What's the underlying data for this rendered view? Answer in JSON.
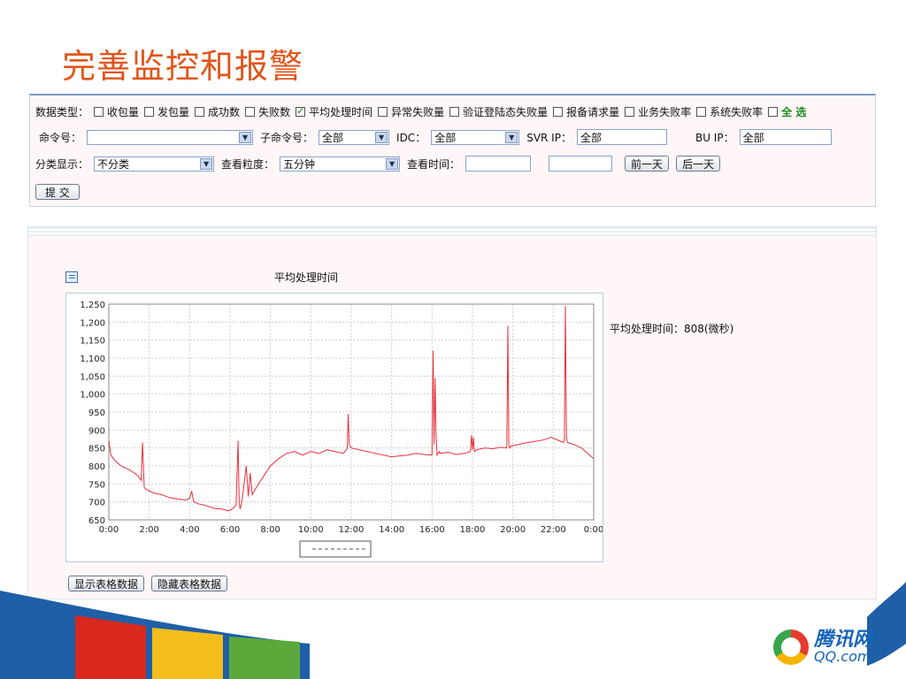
{
  "slide": {
    "title": "完善监控和报警"
  },
  "filters": {
    "data_type_label": "数据类型：",
    "checkboxes": [
      {
        "label": "收包量",
        "checked": false
      },
      {
        "label": "发包量",
        "checked": false
      },
      {
        "label": "成功数",
        "checked": false
      },
      {
        "label": "失败数",
        "checked": false
      },
      {
        "label": "平均处理时间",
        "checked": true
      },
      {
        "label": "异常失败量",
        "checked": false
      },
      {
        "label": "验证登陆态失败量",
        "checked": false
      },
      {
        "label": "报备请求量",
        "checked": false
      },
      {
        "label": "业务失败率",
        "checked": false
      },
      {
        "label": "系统失败率",
        "checked": false
      }
    ],
    "select_all": "全 选",
    "command_label": "命令号：",
    "command_value": "",
    "subcommand_label": "子命令号：",
    "subcommand_value": "全部",
    "idc_label": "IDC：",
    "idc_value": "全部",
    "svr_ip_label": "SVR IP：",
    "svr_ip_value": "全部",
    "bu_ip_label": "BU IP：",
    "bu_ip_value": "全部",
    "category_label": "分类显示：",
    "category_value": "不分类",
    "granularity_label": "查看粒度：",
    "granularity_value": "五分钟",
    "view_time_label": "查看时间：",
    "view_time_value": "",
    "view_time_value2": "",
    "prev_day": "前一天",
    "next_day": "后一天",
    "submit": "提 交"
  },
  "chart_section": {
    "heading": "平均处理时间",
    "side_stat": "平均处理时间：808(微秒)",
    "show_table": "显示表格数据",
    "hide_table": "隐藏表格数据"
  },
  "colors": {
    "line": "#e8303a",
    "title": "#e0561c",
    "accent": "#1a8a1a"
  },
  "chart_data": {
    "type": "line",
    "title": "",
    "xlabel": "",
    "ylabel": "",
    "ylim": [
      650,
      1250
    ],
    "xlim": [
      0,
      24
    ],
    "yticks": [
      "650",
      "700",
      "750",
      "800",
      "850",
      "900",
      "950",
      "1,000",
      "1,050",
      "1,100",
      "1,150",
      "1,200",
      "1,250"
    ],
    "xticks": [
      "0:00",
      "2:00",
      "4:00",
      "6:00",
      "8:00",
      "10:00",
      "12:00",
      "14:00",
      "16:00",
      "18:00",
      "20:00",
      "22:00",
      "0:00"
    ],
    "grid": true,
    "series": [
      {
        "x": [
          0.0,
          0.1,
          0.3,
          0.6,
          1.0,
          1.4,
          1.6,
          1.67,
          1.75,
          1.85,
          2.2,
          2.6,
          3.0,
          3.4,
          3.8,
          4.0,
          4.1,
          4.2,
          4.4,
          4.8,
          5.2,
          5.6,
          5.9,
          6.1,
          6.3,
          6.4,
          6.45,
          6.5,
          6.6,
          6.8,
          6.9,
          7.0,
          7.1,
          7.3,
          7.7,
          8.0,
          8.4,
          8.8,
          9.2,
          9.6,
          10.0,
          10.4,
          10.8,
          11.2,
          11.6,
          11.8,
          11.85,
          11.9,
          12.0,
          12.4,
          12.8,
          13.2,
          13.6,
          14.0,
          14.4,
          14.8,
          15.2,
          15.6,
          16.0,
          16.05,
          16.1,
          16.15,
          16.2,
          16.25,
          16.3,
          16.35,
          16.4,
          16.8,
          17.2,
          17.6,
          17.9,
          17.95,
          18.0,
          18.05,
          18.1,
          18.2,
          18.6,
          19.0,
          19.4,
          19.7,
          19.75,
          19.8,
          19.85,
          19.9,
          20.3,
          20.7,
          21.1,
          21.5,
          21.9,
          22.3,
          22.5,
          22.55,
          22.6,
          22.65,
          22.7,
          23.0,
          23.4,
          23.8,
          24.0
        ],
        "y": [
          870,
          830,
          815,
          800,
          790,
          775,
          760,
          865,
          740,
          735,
          725,
          720,
          712,
          708,
          705,
          710,
          730,
          700,
          695,
          690,
          682,
          680,
          675,
          680,
          690,
          870,
          700,
          680,
          705,
          800,
          715,
          780,
          720,
          740,
          775,
          800,
          820,
          835,
          840,
          830,
          840,
          835,
          845,
          840,
          835,
          848,
          945,
          860,
          850,
          845,
          840,
          835,
          830,
          825,
          828,
          830,
          835,
          832,
          830,
          1120,
          860,
          1045,
          880,
          830,
          835,
          840,
          835,
          838,
          832,
          835,
          840,
          885,
          845,
          880,
          840,
          845,
          850,
          848,
          852,
          850,
          1190,
          860,
          850,
          855,
          860,
          865,
          868,
          872,
          880,
          870,
          865,
          875,
          1245,
          880,
          865,
          860,
          850,
          830,
          820
        ]
      }
    ]
  }
}
